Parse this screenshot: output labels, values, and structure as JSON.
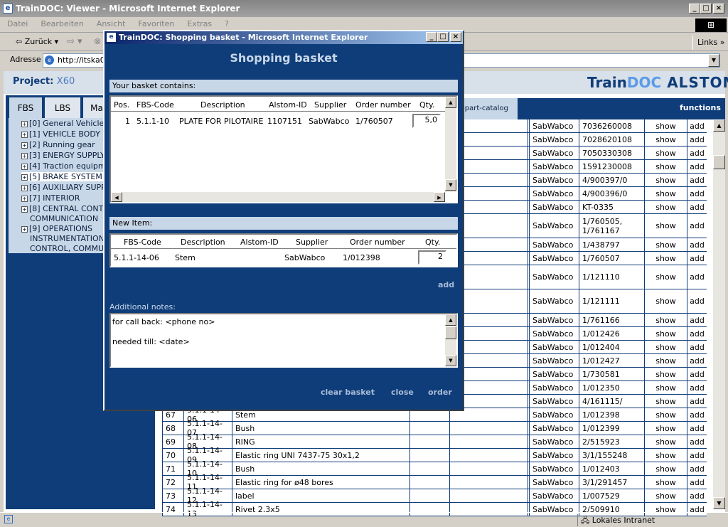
{
  "window": {
    "title": "TrainDOC: Viewer - Microsoft Internet Explorer",
    "icon": "ie-icon"
  },
  "menu": [
    "Datei",
    "Bearbeiten",
    "Ansicht",
    "Favoriten",
    "Extras",
    "?"
  ],
  "toolbar": {
    "back_label": "Zurück",
    "links_label": "Links"
  },
  "address": {
    "label": "Adresse",
    "value": "http://itska0"
  },
  "header": {
    "project_label": "Project:",
    "project_value": "X60",
    "logo_train": "Train",
    "logo_doc": "DOC",
    "logo_alstom": "ALSTOM"
  },
  "tabs": [
    "FBS",
    "LBS",
    "Ma"
  ],
  "tree": [
    "[0] General Vehicle In",
    "[1] VEHICLE BODY",
    "[2] Running gear",
    "[3] ENERGY SUPPLY",
    "[4] Traction equipmen",
    "[5] BRAKE SYSTEM",
    "[6] AUXILIARY SUPPL",
    "[7] INTERIOR",
    "[8] CENTRAL CONTRO",
    "COMMUNICATION",
    "[9] OPERATIONS",
    "INSTRUMENTATION A",
    "CONTROL, COMMUNI"
  ],
  "right_header": {
    "catalog": "are-part-catalog",
    "functions": "functions"
  },
  "parts_rows": [
    {
      "supplier": "SabWabco",
      "order": "7036260008",
      "show": "show",
      "add": "add"
    },
    {
      "supplier": "SabWabco",
      "order": "7028620108",
      "show": "show",
      "add": "add"
    },
    {
      "supplier": "SabWabco",
      "order": "7050330308",
      "show": "show",
      "add": "add"
    },
    {
      "supplier": "SabWabco",
      "order": "1591230008",
      "show": "show",
      "add": "add"
    },
    {
      "supplier": "SabWabco",
      "order": "4/900397/0",
      "show": "show",
      "add": "add"
    },
    {
      "supplier": "SabWabco",
      "order": "4/900396/0",
      "show": "show",
      "add": "add"
    },
    {
      "supplier": "SabWabco",
      "order": "KT-0335",
      "show": "show",
      "add": "add"
    },
    {
      "supplier": "SabWabco",
      "order": "1/760505, 1/761167",
      "show": "show",
      "add": "add"
    },
    {
      "supplier": "SabWabco",
      "order": "1/438797",
      "show": "show",
      "add": "add"
    },
    {
      "supplier": "SabWabco",
      "order": "1/760507",
      "show": "show",
      "add": "add"
    },
    {
      "supplier": "SabWabco",
      "order": "1/121110",
      "show": "show",
      "add": "add"
    },
    {
      "supplier": "SabWabco",
      "order": "1/121111",
      "show": "show",
      "add": "add"
    },
    {
      "supplier": "SabWabco",
      "order": "1/761166",
      "show": "show",
      "add": "add"
    },
    {
      "supplier": "SabWabco",
      "order": "1/012426",
      "show": "show",
      "add": "add"
    },
    {
      "supplier": "SabWabco",
      "order": "1/012404",
      "show": "show",
      "add": "add"
    },
    {
      "supplier": "SabWabco",
      "order": "1/012427",
      "show": "show",
      "add": "add"
    },
    {
      "supplier": "SabWabco",
      "order": "1/730581",
      "show": "show",
      "add": "add"
    },
    {
      "supplier": "SabWabco",
      "order": "1/012350",
      "show": "show",
      "add": "add"
    },
    {
      "supplier": "SabWabco",
      "order": "4/161115/",
      "show": "show",
      "add": "add"
    },
    {
      "pos": "67",
      "code": "5.1.1-14-06",
      "desc": "Stem",
      "supplier": "SabWabco",
      "order": "1/012398",
      "show": "show",
      "add": "add"
    },
    {
      "pos": "68",
      "code": "5.1.1-14-07",
      "desc": "Bush",
      "supplier": "SabWabco",
      "order": "1/012399",
      "show": "show",
      "add": "add"
    },
    {
      "pos": "69",
      "code": "5.1.1-14-08",
      "desc": "RING",
      "supplier": "SabWabco",
      "order": "2/515923",
      "show": "show",
      "add": "add"
    },
    {
      "pos": "70",
      "code": "5.1.1-14-09",
      "desc": "Elastic ring UNI 7437-75 30x1,2",
      "supplier": "SabWabco",
      "order": "3/1/155248",
      "show": "show",
      "add": "add"
    },
    {
      "pos": "71",
      "code": "5.1.1-14-10",
      "desc": "Bush",
      "supplier": "SabWabco",
      "order": "1/012403",
      "show": "show",
      "add": "add"
    },
    {
      "pos": "72",
      "code": "5.1.1-14-11",
      "desc": "Elastic ring for ø48 bores",
      "supplier": "SabWabco",
      "order": "3/1/291457",
      "show": "show",
      "add": "add"
    },
    {
      "pos": "73",
      "code": "5.1.1-14-12",
      "desc": "label",
      "supplier": "SabWabco",
      "order": "1/007529",
      "show": "show",
      "add": "add"
    },
    {
      "pos": "74",
      "code": "5.1.1-14-13",
      "desc": "Rivet 2,3x5",
      "supplier": "SabWabco",
      "order": "2/509910",
      "show": "show",
      "add": "add"
    }
  ],
  "status": {
    "zone": "Lokales Intranet"
  },
  "popup": {
    "title": "TrainDOC: Shopping basket - Microsoft Internet Explorer",
    "heading": "Shopping basket",
    "basket_label": "Your basket contains:",
    "basket_headers": [
      "Pos.",
      "FBS-Code",
      "Description",
      "Alstom-ID",
      "Supplier",
      "Order number",
      "Qty."
    ],
    "basket_row": {
      "pos": "1",
      "code": "5.1.1-10",
      "desc": "PLATE FOR PILOTAIRE",
      "alstom": "1107151",
      "supplier": "SabWabco",
      "order": "1/760507",
      "qty": "5,0"
    },
    "new_label": "New Item:",
    "new_headers": [
      "FBS-Code",
      "Description",
      "Alstom-ID",
      "Supplier",
      "Order number",
      "Qty."
    ],
    "new_row": {
      "code": "5.1.1-14-06",
      "desc": "Stem",
      "alstom": "",
      "supplier": "SabWabco",
      "order": "1/012398",
      "qty": "2"
    },
    "add_label": "add",
    "notes_label": "Additional notes:",
    "notes_line1": "for call back: <phone no>",
    "notes_line2": "needed till: <date>",
    "clear_label": "clear basket",
    "close_label": "close",
    "order_label": "order"
  }
}
